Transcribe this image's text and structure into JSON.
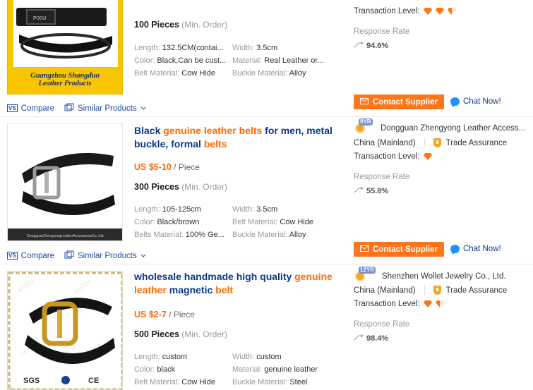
{
  "listings": [
    {
      "moq_qty": "100 Pieces",
      "moq_note": "(Min. Order)",
      "attrs": {
        "length_k": "Length:",
        "length_v": "132.5CM(contai...",
        "width_k": "Width:",
        "width_v": "3.5cm",
        "color_k": "Color:",
        "color_v": "Black,Can be cust...",
        "material_k": "Material:",
        "material_v": "Real Leather or...",
        "belt_k": "Belt Material:",
        "belt_v": "Cow Hide",
        "buckle_k": "Buckle Material:",
        "buckle_v": "Alloy"
      },
      "image_caption_1": "Guangzhou Shangduo",
      "image_caption_2": "Leather Products",
      "buckle_text": "PIXIU",
      "transaction_label": "Transaction Level:",
      "response_label": "Response Rate",
      "response_rate": "94.6%",
      "contact_label": "Contact Supplier",
      "chat_label": "Chat Now!",
      "compare_label": "Compare",
      "similar_label": "Similar Products"
    },
    {
      "title_1": "Black ",
      "title_kw1": "genuine leather belts",
      "title_2": " for men, metal buckle, formal ",
      "title_kw2": "belts",
      "price_amt": "US $5-10",
      "price_unit": " / Piece",
      "moq_qty": "300 Pieces",
      "moq_note": "(Min. Order)",
      "attrs": {
        "length_k": "Length:",
        "length_v": "105-125cm",
        "width_k": "Width:",
        "width_v": "3.5cm",
        "color_k": "Color:",
        "color_v": "Black/brown",
        "material_k": "Belt Material:",
        "material_v": "Cow Hide",
        "belt_k": "Belts Material:",
        "belt_v": "100% Ge...",
        "buckle_k": "Buckle Material:",
        "buckle_v": "Alloy"
      },
      "image_caption": "DongguanZhengyongLeatherAccessoriesCo.,Ltd.",
      "years": "9",
      "yr_suffix": "YR",
      "company": "Dongguan Zhengyong Leather Access...",
      "country": "China (Mainland)",
      "trade_assurance": "Trade Assurance",
      "transaction_label": "Transaction Level:",
      "response_label": "Response Rate",
      "response_rate": "55.8%",
      "contact_label": "Contact Supplier",
      "chat_label": "Chat Now!",
      "compare_label": "Compare",
      "similar_label": "Similar Products"
    },
    {
      "title_1": "wholesale handmade high quality ",
      "title_kw1": "genuine leather",
      "title_2": " magnetic ",
      "title_kw2": "belt",
      "price_amt": "US $2-7",
      "price_unit": " / Piece",
      "moq_qty": "500 Pieces",
      "moq_note": "(Min. Order)",
      "attrs": {
        "length_k": "Length:",
        "length_v": "custom",
        "width_k": "Width:",
        "width_v": "custom",
        "color_k": "Color:",
        "color_v": "black",
        "material_k": "Material:",
        "material_v": "genuine leather",
        "belt_k": "Belt Material:",
        "belt_v": "Cow Hide",
        "buckle_k": "Buckle Material:",
        "buckle_v": "Steel"
      },
      "watermark": "wollet",
      "cert_sgs": "SGS",
      "cert_ce": "CE",
      "years": "12",
      "yr_suffix": "YR",
      "company": "Shenzhen Wollet Jewelry Co., Ltd.",
      "country": "China (Mainland)",
      "trade_assurance": "Trade Assurance",
      "transaction_label": "Transaction Level:",
      "response_label": "Response Rate",
      "response_rate": "98.4%"
    }
  ],
  "colors": {
    "accent": "#ff6a00",
    "link": "#0b3a8b",
    "button": "#ff7519"
  }
}
